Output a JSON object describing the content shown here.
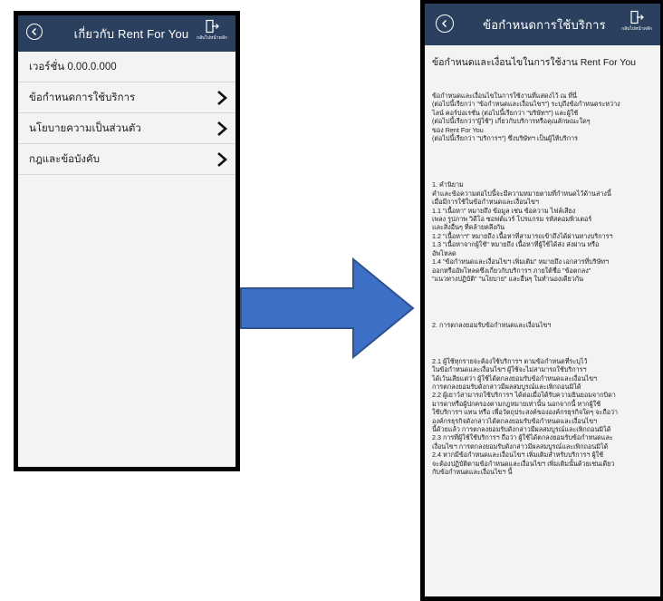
{
  "left_screen": {
    "header": {
      "title": "เกี่ยวกับ Rent For You",
      "exit_label": "กลับไปหน้าหลัก"
    },
    "version": "เวอร์ชั่น 0.00.0.000",
    "menu": [
      {
        "label": "ข้อกำหนดการใช้บริการ"
      },
      {
        "label": "นโยบายความเป็นส่วนตัว"
      },
      {
        "label": "กฎและข้อบังคับ"
      }
    ]
  },
  "right_screen": {
    "header": {
      "title": "ข้อกำหนดการใช้บริการ",
      "exit_label": "กลับไปหน้าหลัก"
    },
    "doc_title": "ข้อกำหนดและเงื่อนไขในการใช้งาน Rent For You",
    "intro": "ข้อกำหนดและเงื่อนไขในการใช้งานที่แสดงไว้ ณ ที่นี่\n(ต่อไปนี้เรียกว่า \"ข้อกำหนดและเงื่อนไขฯ\") ระบุถึงข้อกำหนดระหว่าง\nไลน์ คอร์ปอเรชั่น (ต่อไปนี้เรียกว่า \"บริษัทฯ\") และผู้ใช้\n(ต่อไปนี้เรียกว่า\"ผู้ใช้\") เกี่ยวกับบริการหรือคุณลักษณะใดๆ\nของ Rent For You\n(ต่อไปนี้เรียกว่า \"บริการฯ\") ซึ่งบริษัทฯ เป็นผู้ให้บริการ",
    "section1": "1. คำนิยาม\nคำและข้อความต่อไปนี้จะมีความหมายตามที่กำหนดไว้ด้านล่างนี้\nเมื่อมีการใช้ในข้อกำหนดและเงื่อนไขฯ\n1.1 \"เนื้อหา\" หมายถึง ข้อมูล เช่น ข้อความ ไฟล์เสียง\n เพลง รูปภาพ วิดีโอ ซอฟต์แวร์ โปรแกรม รหัสคอมพิวเตอร์\nและสิ่งอื่นๆ ที่คล้ายคลึงกัน\n1.2 \"เนื้อหาฯ\" หมายถึง เนื้อหาที่สามารถเข้าถึงได้ผ่านทางบริการฯ\n1.3 \"เนื้อหาจากผู้ใช้\" หมายถึง เนื้อหาที่ผู้ใช้ได้ส่ง ส่งผ่าน หรือ\nอัพโหลด\n1.4 \"ข้อกำหนดและเงื่อนไขฯ เพิ่มเติม\" หมายถึง เอกสารที่บริษัทฯ\n ออกหรืออัพโหลดซึ่งเกี่ยวกับบริการฯ ภายใต้ชื่อ \"ข้อตกลง\"\n\"แนวทางปฏิบัติ\" \"นโยบาย\" และอื่นๆ ในทำนองเดียวกัน",
    "section2_heading": "2. การตกลงยอมรับข้อกำหนดและเงื่อนไขฯ",
    "section2": "2.1 ผู้ใช้ทุกรายจะต้องใช้บริการฯ ตามข้อกำหนดที่ระบุไว้\nในข้อกำหนดและเงื่อนไขฯ ผู้ใช้จะไม่สามารถใช้บริการฯ\nได้เว้นเสียแต่ว่า ผู้ใช้ได้ตกลงยอมรับข้อกำหนดและเงื่อนไขฯ\n การตกลงยอมรับดังกล่าวมีผลสมบูรณ์และเพิกถอนมิได้\n2.2 ผู้เยาว์สามารถใช้บริการฯ ได้ต่อเมื่อได้รับความยินยอมจากบิดา\nมารดาหรือผู้ปกครองตามกฎหมายเท่านั้น นอกจากนี้ หากผู้ใช้\nใช้บริการฯ แทน หรือ เพื่อวัตถุประสงค์ขององค์กรธุรกิจใดๆ จะถือว่า\n องค์กรธุรกิจดังกล่าวได้ตกลงยอมรับข้อกำหนดและเงื่อนไขฯ\nนี้ด้วยแล้ว การตกลงยอมรับดังกล่าวมีผลสมบูรณ์และเพิกถอนมิได้\n2.3 การที่ผู้ใช้ใช้บริการฯ ถือว่า ผู้ใช้ได้ตกลงยอมรับข้อกำหนดและ\nเงื่อนไขฯ การตกลงยอมรับดังกล่าวมีผลสมบูรณ์และเพิกถอนมิได้\n2.4 หากมีข้อกำหนดและเงื่อนไขฯ เพิ่มเติมสำหรับบริการฯ ผู้ใช้\nจะต้องปฏิบัติตามข้อกำหนดและเงื่อนไขฯ เพิ่มเติมนั้นด้วยเช่นเดียว\nกับข้อกำหนดและเงื่อนไขฯ นี้"
  },
  "colors": {
    "header_bg": "#2b3f5e",
    "arrow_fill": "#3d6fc7",
    "arrow_stroke": "#2f528f"
  }
}
